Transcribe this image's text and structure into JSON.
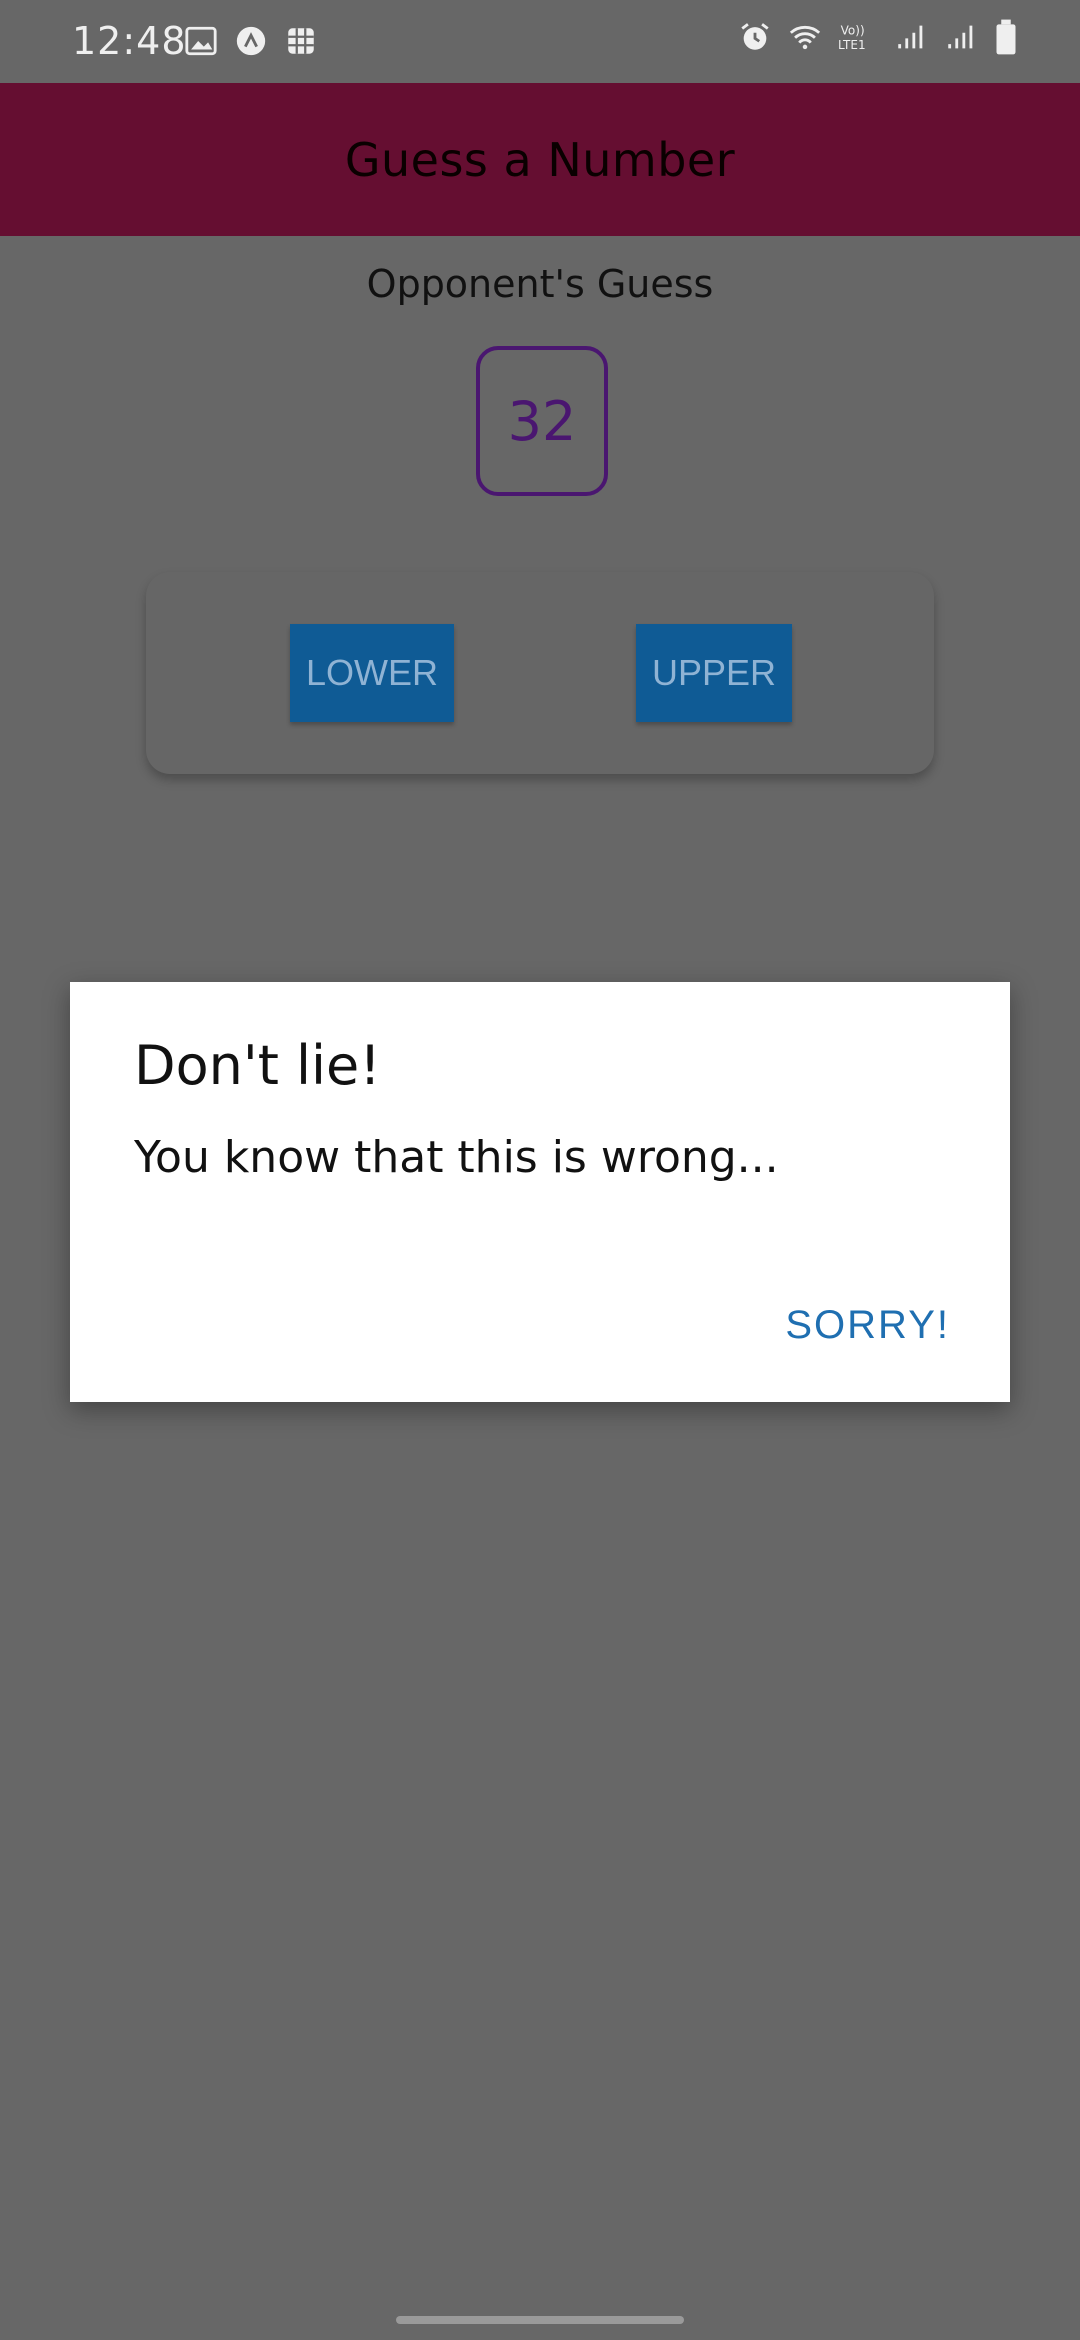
{
  "status_bar": {
    "time": "12:48",
    "icons_left": [
      "gallery-icon",
      "app-icon",
      "grid-icon"
    ],
    "icons_right": [
      "alarm-icon",
      "wifi-icon",
      "volte-icon",
      "signal-icon",
      "signal-icon-2",
      "battery-icon"
    ],
    "volte_label": "Vo)) LTE1"
  },
  "header": {
    "title": "Guess a Number",
    "background": "#650e31"
  },
  "game": {
    "opponent_label": "Opponent's Guess",
    "guess_value": "32",
    "lower_label": "LOWER",
    "upper_label": "UPPER",
    "button_color": "#0f5b95"
  },
  "dialog": {
    "title": "Don't lie!",
    "message": "You know that this is wrong...",
    "action_label": "SORRY!",
    "action_color": "#1f6fb1"
  }
}
